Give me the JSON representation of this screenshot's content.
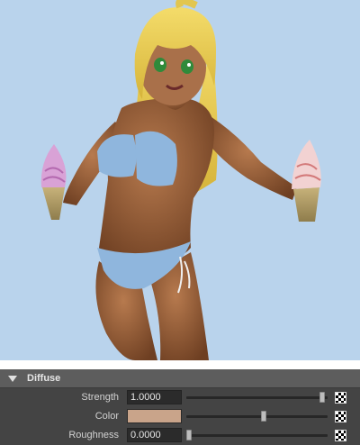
{
  "viewport": {
    "background": "#b9d3ec",
    "content": "rendered 3D character preview"
  },
  "panel": {
    "section_title": "Diffuse",
    "rows": [
      {
        "label": "Strength",
        "value": "1.0000",
        "slider": 0.98,
        "map_icon": "checker-icon"
      },
      {
        "label": "Color",
        "color": "#c9a48a",
        "slider": 0.55,
        "map_icon": "checker-icon"
      },
      {
        "label": "Roughness",
        "value": "0.0000",
        "slider": 0.0,
        "map_icon": "checker-icon"
      }
    ]
  }
}
